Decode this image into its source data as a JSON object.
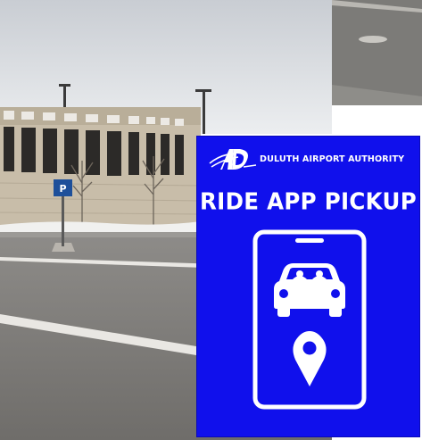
{
  "sign": {
    "organization": "DULUTH AIRPORT AUTHORITY",
    "logo_letters": "AD",
    "title": "RIDE APP PICKUP",
    "background_color": "#1010ec",
    "icons": [
      "duluth-airport-logo-icon",
      "smartphone-icon",
      "car-icon",
      "location-pin-icon"
    ]
  },
  "photo": {
    "scene": "parking-lot-with-parking-garage",
    "signpost_icons": [
      "parking-sign-icon"
    ]
  }
}
